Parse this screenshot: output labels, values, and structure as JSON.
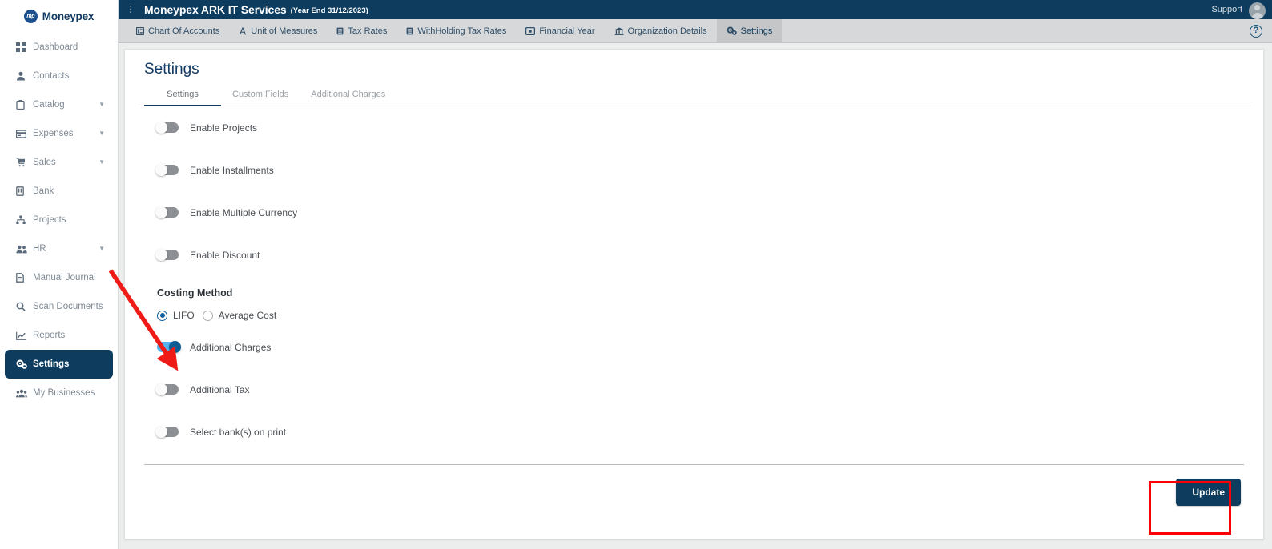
{
  "brand": {
    "name": "Moneypex",
    "mark": "mp",
    "icon": "moneypex-logo-icon"
  },
  "sidebar": {
    "items": [
      {
        "label": "Dashboard",
        "icon": "grid-icon",
        "caret": false,
        "active": false
      },
      {
        "label": "Contacts",
        "icon": "person-icon",
        "caret": false,
        "active": false
      },
      {
        "label": "Catalog",
        "icon": "clipboard-icon",
        "caret": true,
        "active": false
      },
      {
        "label": "Expenses",
        "icon": "card-icon",
        "caret": true,
        "active": false
      },
      {
        "label": "Sales",
        "icon": "cart-icon",
        "caret": true,
        "active": false
      },
      {
        "label": "Bank",
        "icon": "bank-icon",
        "caret": false,
        "active": false
      },
      {
        "label": "Projects",
        "icon": "sitemap-icon",
        "caret": false,
        "active": false
      },
      {
        "label": "HR",
        "icon": "people-icon",
        "caret": true,
        "active": false
      },
      {
        "label": "Manual Journal",
        "icon": "journal-icon",
        "caret": false,
        "active": false
      },
      {
        "label": "Scan Documents",
        "icon": "search-icon",
        "caret": false,
        "active": false
      },
      {
        "label": "Reports",
        "icon": "chart-icon",
        "caret": false,
        "active": false
      },
      {
        "label": "Settings",
        "icon": "gears-icon",
        "caret": false,
        "active": true
      },
      {
        "label": "My Businesses",
        "icon": "people-group-icon",
        "caret": false,
        "active": false
      }
    ]
  },
  "topbar": {
    "menu_icon": "kebab-menu-icon",
    "title": "Moneypex ARK IT Services",
    "subtitle": "(Year End 31/12/2023)",
    "support_label": "Support",
    "avatar_icon": "user-avatar-icon"
  },
  "nav_tabs": {
    "items": [
      {
        "label": "Chart Of Accounts",
        "icon": "chart-accounts-icon",
        "selected": false
      },
      {
        "label": "Unit of Measures",
        "icon": "compass-icon",
        "selected": false
      },
      {
        "label": "Tax Rates",
        "icon": "tax-icon",
        "selected": false
      },
      {
        "label": "WithHolding Tax Rates",
        "icon": "tax-icon",
        "selected": false
      },
      {
        "label": "Financial Year",
        "icon": "calendar-icon",
        "selected": false
      },
      {
        "label": "Organization Details",
        "icon": "bank-building-icon",
        "selected": false
      },
      {
        "label": "Settings",
        "icon": "gears-icon",
        "selected": true
      }
    ],
    "help_icon": "help-question-icon",
    "help_label": "?"
  },
  "page": {
    "title": "Settings",
    "subtabs": [
      {
        "label": "Settings",
        "selected": true
      },
      {
        "label": "Custom Fields",
        "selected": false
      },
      {
        "label": "Additional Charges",
        "selected": false
      }
    ]
  },
  "settings_form": {
    "toggles_top": [
      {
        "label": "Enable Projects",
        "on": false
      },
      {
        "label": "Enable Installments",
        "on": false
      },
      {
        "label": "Enable Multiple Currency",
        "on": false
      },
      {
        "label": "Enable Discount",
        "on": false
      }
    ],
    "costing_method": {
      "title": "Costing Method",
      "options": [
        {
          "label": "LIFO",
          "selected": true
        },
        {
          "label": "Average Cost",
          "selected": false
        }
      ]
    },
    "toggles_bottom": [
      {
        "label": "Additional Charges",
        "on": true
      },
      {
        "label": "Additional Tax",
        "on": false
      },
      {
        "label": "Select bank(s) on print",
        "on": false
      }
    ],
    "update_label": "Update"
  },
  "annotations": {
    "arrow_color": "#ee1b17",
    "highlight_color": "#fb0007",
    "arrow_target": "additional-charges-toggle",
    "highlight_target": "update-button"
  },
  "colors": {
    "navy": "#0d3c5e",
    "toggle_on_track": "#54b4ef",
    "toggle_on_knob": "#0c5c96",
    "toggle_off": "#8c9094",
    "tabstrip": "#d7d8d9"
  }
}
